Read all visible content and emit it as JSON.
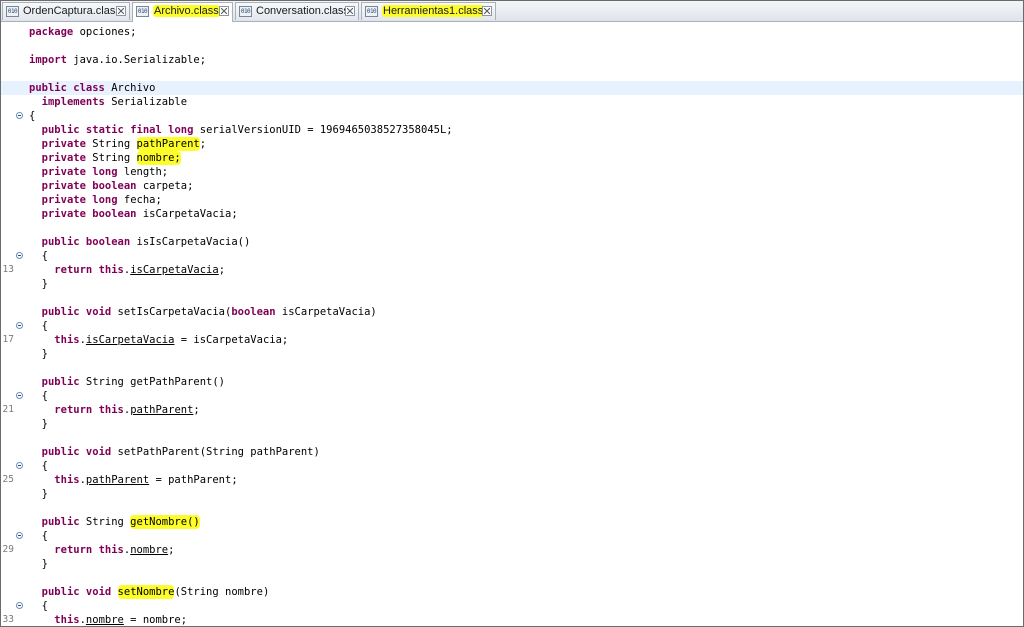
{
  "tabs": [
    {
      "label": "OrdenCaptura.class",
      "icon": "class-file-icon",
      "icon_text": "010",
      "active": false,
      "highlighted": false
    },
    {
      "label": "Archivo.class",
      "icon": "class-file-icon",
      "icon_text": "010",
      "active": true,
      "highlighted": true
    },
    {
      "label": "Conversation.class",
      "icon": "class-file-icon",
      "icon_text": "010",
      "active": false,
      "highlighted": false
    },
    {
      "label": "Herramientas1.class",
      "icon": "class-file-icon",
      "icon_text": "010",
      "active": false,
      "highlighted": true
    }
  ],
  "editor": {
    "highlight_color": "#fdfd2a",
    "keyword_color": "#7f0055",
    "line_numbers": {
      "13": "13",
      "17": "17",
      "21": "21",
      "25": "25",
      "29": "29",
      "33": "33"
    },
    "tokens": {
      "package": "package",
      "import": "import",
      "public": "public",
      "class": "class",
      "implements": "implements",
      "static": "static",
      "final": "final",
      "long": "long",
      "private": "private",
      "boolean": "boolean",
      "return": "return",
      "this": "this",
      "void": "void",
      "package_rest": " opciones;",
      "import_rest": " java.io.Serializable;",
      "class_name": " Archivo",
      "implements_rest": " Serializable",
      "open_brace": "{",
      "close_brace": "}",
      "serial_rest": " serialVersionUID = 1969465038527358045L;",
      "string_type": " String ",
      "pathParent_field": "pathParent",
      "nombre_field": "nombre;",
      "semicolon": ";",
      "length_rest": " length;",
      "carpeta_rest": " carpeta;",
      "fecha_rest": " fecha;",
      "isCarpetaVacia_decl": " isCarpetaVacia;",
      "isIsCarpetaVacia_sig": " isIsCarpetaVacia()",
      "dot": ".",
      "isCarpetaVacia": "isCarpetaVacia",
      "setIsCarpetaVacia_sig": " setIsCarpetaVacia(",
      "boolean_param_rest": " isCarpetaVacia)",
      "assign_isCarpetaVacia": " = isCarpetaVacia;",
      "getPathParent_sig": " String getPathParent()",
      "pathParent": "pathParent",
      "setPathParent_sig": " setPathParent(String pathParent)",
      "assign_pathParent": " = pathParent;",
      "getNombre_sig": "getNombre()",
      "nombre": "nombre",
      "setNombre_name": "setNombre",
      "setNombre_rest": "(String nombre)",
      "assign_nombre": " = nombre;",
      "space": " "
    }
  }
}
